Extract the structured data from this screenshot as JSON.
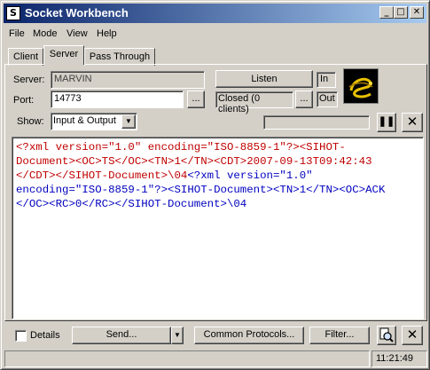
{
  "window": {
    "title": "Socket Workbench"
  },
  "menu": [
    "File",
    "Mode",
    "View",
    "Help"
  ],
  "tabs": [
    "Client",
    "Server",
    "Pass Through"
  ],
  "server": {
    "server_label": "Server:",
    "server_value": "MARVIN",
    "port_label": "Port:",
    "port_value": "14773",
    "browse_label": "...",
    "listen_label": "Listen",
    "status_text": "Closed (0 clients)",
    "in_label": "In",
    "out_label": "Out",
    "show_label": "Show:",
    "show_value": "Input & Output"
  },
  "output_lines": [
    {
      "color": "red",
      "text": "<?xml version=\"1.0\" encoding=\"ISO-8859-1\"?><SIHOT-"
    },
    {
      "color": "red",
      "text": "Document><OC>TS</OC><TN>1</TN><CDT>2007-09-13T09:42:43"
    },
    {
      "color": "mixed",
      "red": "</CDT></SIHOT-Document>\\04",
      "blue": "<?xml version=\"1.0\""
    },
    {
      "color": "blue",
      "text": "encoding=\"ISO-8859-1\"?><SIHOT-Document><TN>1</TN><OC>ACK"
    },
    {
      "color": "blue",
      "text": "</OC><RC>0</RC></SIHOT-Document>\\04"
    }
  ],
  "bottom": {
    "details_label": "Details",
    "send_label": "Send...",
    "protocols_label": "Common Protocols...",
    "filter_label": "Filter..."
  },
  "status": {
    "time": "11:21:49"
  }
}
